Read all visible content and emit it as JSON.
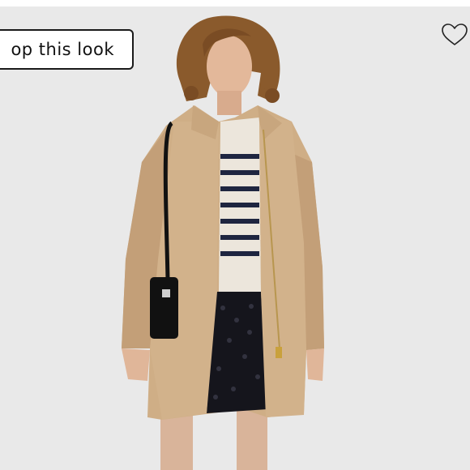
{
  "product_view": {
    "shop_look_label": "op this look",
    "icons": {
      "favorite": "heart-outline-icon"
    },
    "colors": {
      "background": "#e9e9e9",
      "coat": "#cfae86",
      "sweater_stripe": "#1e2540",
      "skirt": "#15151c",
      "bag": "#111111",
      "button_border": "#1a1a1a"
    }
  }
}
